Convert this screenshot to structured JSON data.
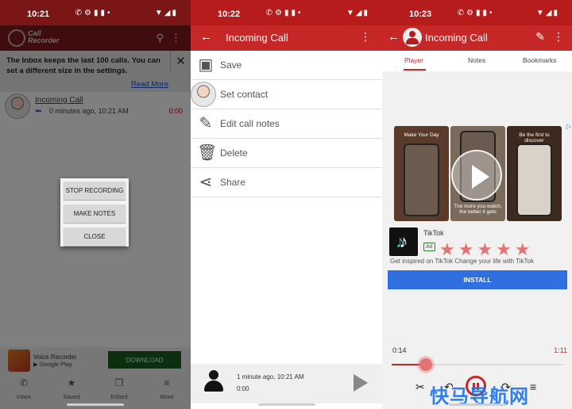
{
  "screen1": {
    "status_time": "10:21",
    "app_name_line1": "Call",
    "app_name_line2": "Recorder",
    "banner_text": "The Inbox keeps the last 100 calls. You can set a different size in the settings.",
    "banner_link": "Read More",
    "call": {
      "title": "Incoming Call",
      "subtitle": "0 minutes ago, 10:21 AM",
      "duration": "0:00"
    },
    "dialog_buttons": [
      "STOP RECORDING",
      "MAKE NOTES",
      "CLOSE"
    ],
    "ad": {
      "name": "Voice Recorder",
      "store": "Google Play",
      "button": "DOWNLOAD"
    },
    "nav": [
      "Inbox",
      "Saved",
      "Edited",
      "More"
    ]
  },
  "screen2": {
    "status_time": "10:22",
    "title": "Incoming Call",
    "menu": [
      "Save",
      "Set contact",
      "Edit call notes",
      "Delete",
      "Share"
    ],
    "player": {
      "time": "1 minute ago, 10:21 AM",
      "duration": "0:00"
    }
  },
  "screen3": {
    "status_time": "10:23",
    "title": "Incoming Call",
    "tabs": [
      "Player",
      "Notes",
      "Bookmarks"
    ],
    "ad": {
      "shot_captions": [
        "Make Your Day",
        "The more you watch, the better it gets",
        "Be the first to discover"
      ],
      "name": "TikTok",
      "badge": "Ad",
      "description": "Get inspired on TikTok Change your life with TikTok",
      "button": "INSTALL"
    },
    "time_elapsed": "0:14",
    "time_total": "1:11",
    "progress_fraction": 0.2,
    "watermark": "快马导航网"
  },
  "colors": {
    "primary": "#c62828",
    "status": "#b71c1c",
    "install_blue": "#2f6fe0",
    "download_green": "#1b5e20"
  }
}
